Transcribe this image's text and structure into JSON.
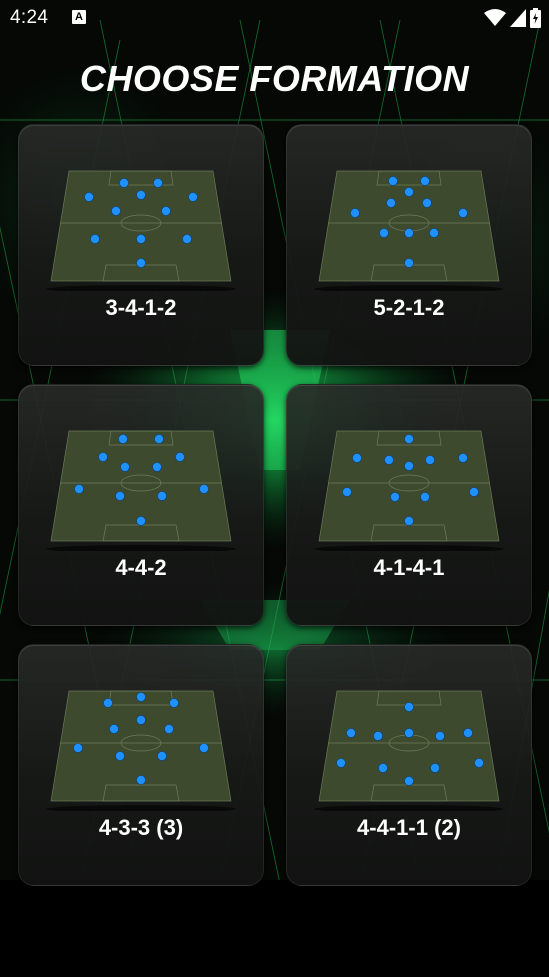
{
  "status_bar": {
    "time": "4:24",
    "notification_icon": "a-icon",
    "a_letter": "A",
    "wifi_icon": "wifi-icon",
    "signal_icon": "signal-icon",
    "battery_icon": "battery-charging-icon"
  },
  "title": "CHOOSE FORMATION",
  "colors": {
    "accent_green": "#1fd15a",
    "player_blue": "#1e90ff",
    "pitch_green": "#3b4a2c"
  },
  "formations": [
    {
      "label": "3-4-1-2"
    },
    {
      "label": "5-2-1-2"
    },
    {
      "label": "4-4-2"
    },
    {
      "label": "4-1-4-1"
    },
    {
      "label": "4-3-3 (3)"
    },
    {
      "label": "4-4-1-1 (2)"
    }
  ]
}
